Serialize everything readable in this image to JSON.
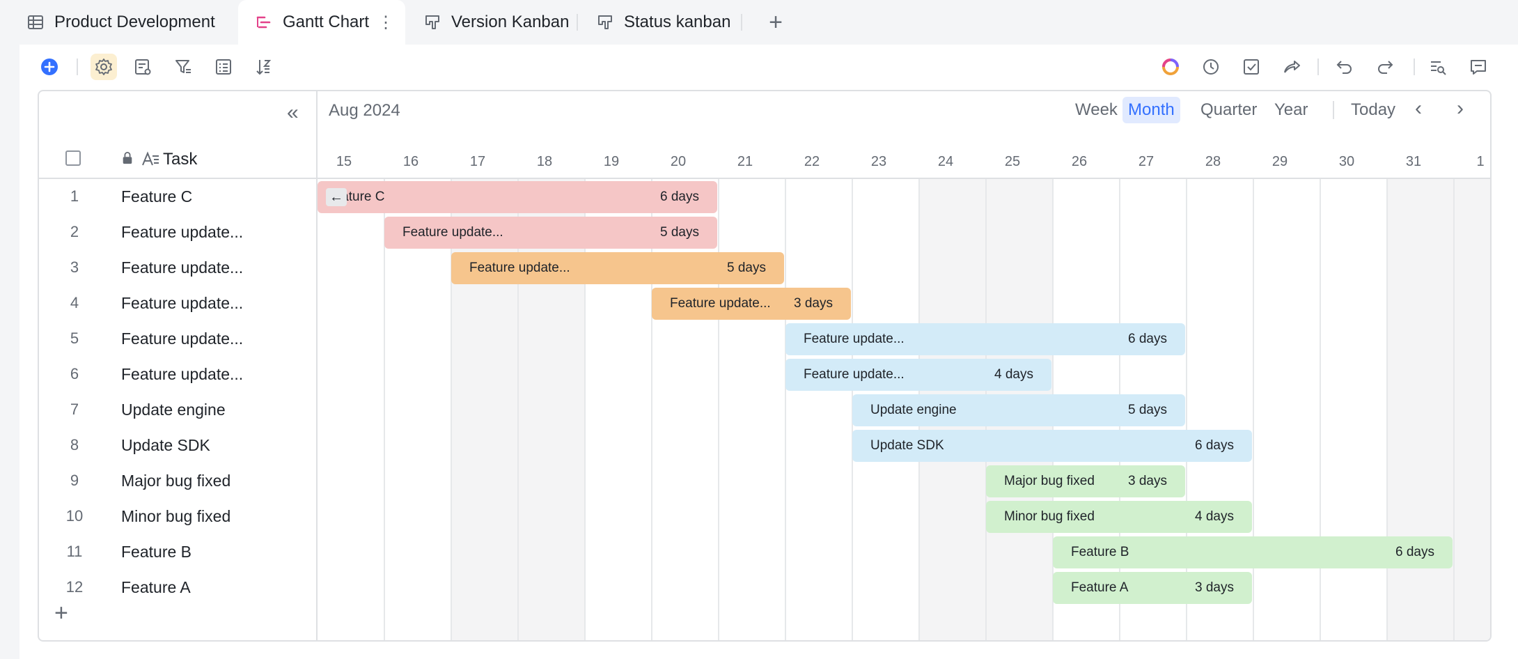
{
  "tabs": [
    {
      "label": "Product Development",
      "icon": "grid-table-icon",
      "active": false
    },
    {
      "label": "Gantt Chart",
      "icon": "gantt-icon",
      "active": true
    },
    {
      "label": "Version Kanban",
      "icon": "kanban-icon",
      "active": false
    },
    {
      "label": "Status kanban",
      "icon": "kanban-icon",
      "active": false
    }
  ],
  "tab_more": "⋮",
  "add_tab": "+",
  "toolbar": {
    "left": [
      "add-record-icon",
      "settings-icon",
      "field-settings-icon",
      "filter-icon",
      "group-icon",
      "sort-icon"
    ],
    "right": [
      "ai-assistant-icon",
      "history-icon",
      "task-check-icon",
      "share-icon",
      "undo-icon",
      "redo-icon",
      "search-icon",
      "comment-icon"
    ]
  },
  "gantt": {
    "collapse_label": "«",
    "task_header": "Task",
    "period": "Aug 2024",
    "views": [
      "Week",
      "Month",
      "Quarter",
      "Year"
    ],
    "active_view": "Month",
    "today": "Today",
    "prev": "‹",
    "next": "›",
    "days": [
      "15",
      "16",
      "17",
      "18",
      "19",
      "20",
      "21",
      "22",
      "23",
      "24",
      "25",
      "26",
      "27",
      "28",
      "29",
      "30",
      "31",
      "1"
    ],
    "weekend_days": [
      "17",
      "18",
      "24",
      "25",
      "31",
      "1"
    ],
    "add_row": "+"
  },
  "colors": {
    "red": "#f5c6c6",
    "orange": "#f6c58d",
    "blue": "#d3ebf8",
    "green": "#d1f0ce",
    "accent": "#3370ff"
  },
  "rows": [
    {
      "num": "1",
      "task": "Feature C",
      "bar_label": "Feature C",
      "days_label": "6 days",
      "start": "2024-08-15",
      "end": "2024-08-20",
      "color": "red"
    },
    {
      "num": "2",
      "task": "Feature update...",
      "bar_label": "Feature update...",
      "days_label": "5 days",
      "start": "2024-08-16",
      "end": "2024-08-20",
      "color": "red"
    },
    {
      "num": "3",
      "task": "Feature update...",
      "bar_label": "Feature update...",
      "days_label": "5 days",
      "start": "2024-08-17",
      "end": "2024-08-21",
      "color": "orange"
    },
    {
      "num": "4",
      "task": "Feature update...",
      "bar_label": "Feature update...",
      "days_label": "3 days",
      "start": "2024-08-20",
      "end": "2024-08-22",
      "color": "orange"
    },
    {
      "num": "5",
      "task": "Feature update...",
      "bar_label": "Feature update...",
      "days_label": "6 days",
      "start": "2024-08-22",
      "end": "2024-08-27",
      "color": "blue"
    },
    {
      "num": "6",
      "task": "Feature update...",
      "bar_label": "Feature update...",
      "days_label": "4 days",
      "start": "2024-08-22",
      "end": "2024-08-25",
      "color": "blue"
    },
    {
      "num": "7",
      "task": "Update engine",
      "bar_label": "Update engine",
      "days_label": "5 days",
      "start": "2024-08-23",
      "end": "2024-08-27",
      "color": "blue"
    },
    {
      "num": "8",
      "task": "Update SDK",
      "bar_label": "Update SDK",
      "days_label": "6 days",
      "start": "2024-08-23",
      "end": "2024-08-28",
      "color": "blue"
    },
    {
      "num": "9",
      "task": "Major bug fixed",
      "bar_label": "Major bug fixed",
      "days_label": "3 days",
      "start": "2024-08-25",
      "end": "2024-08-27",
      "color": "green"
    },
    {
      "num": "10",
      "task": "Minor bug fixed",
      "bar_label": "Minor bug fixed",
      "days_label": "4 days",
      "start": "2024-08-25",
      "end": "2024-08-28",
      "color": "green"
    },
    {
      "num": "11",
      "task": "Feature B",
      "bar_label": "Feature B",
      "days_label": "6 days",
      "start": "2024-08-26",
      "end": "2024-08-31",
      "color": "green"
    },
    {
      "num": "12",
      "task": "Feature A",
      "bar_label": "Feature A",
      "days_label": "3 days",
      "start": "2024-08-26",
      "end": "2024-08-28",
      "color": "green"
    }
  ]
}
